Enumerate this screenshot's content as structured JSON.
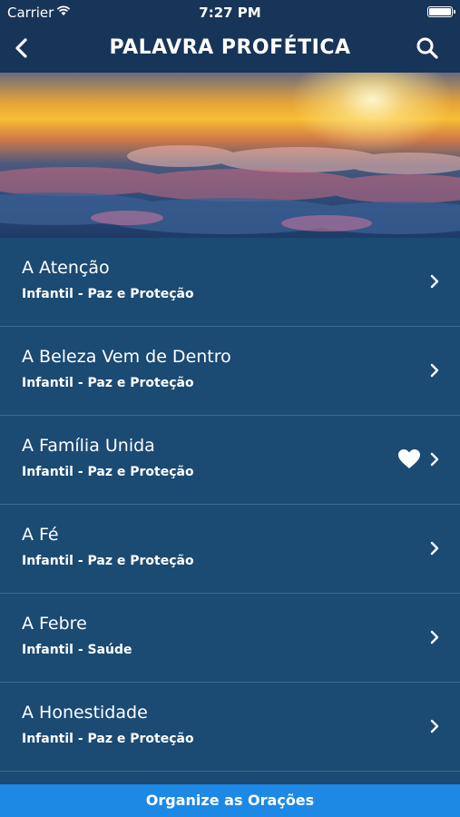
{
  "status": {
    "carrier": "Carrier",
    "time": "7:27 PM"
  },
  "nav": {
    "title": "PALAVRA PROFÉTICA"
  },
  "colors": {
    "navbar": "#173558",
    "list_bg": "#1b4a73",
    "divider": "#3f6a92",
    "footer": "#1e88e5"
  },
  "items": [
    {
      "title": "A Atenção",
      "subtitle": "Infantil - Paz e Proteção",
      "favorite": false
    },
    {
      "title": "A Beleza Vem de Dentro",
      "subtitle": "Infantil - Paz e Proteção",
      "favorite": false
    },
    {
      "title": "A Família Unida",
      "subtitle": "Infantil - Paz e Proteção",
      "favorite": true
    },
    {
      "title": "A Fé",
      "subtitle": "Infantil - Paz e Proteção",
      "favorite": false
    },
    {
      "title": "A Febre",
      "subtitle": "Infantil - Saúde",
      "favorite": false
    },
    {
      "title": "A Honestidade",
      "subtitle": "Infantil - Paz e Proteção",
      "favorite": false
    }
  ],
  "footer": {
    "label": "Organize as Orações"
  }
}
